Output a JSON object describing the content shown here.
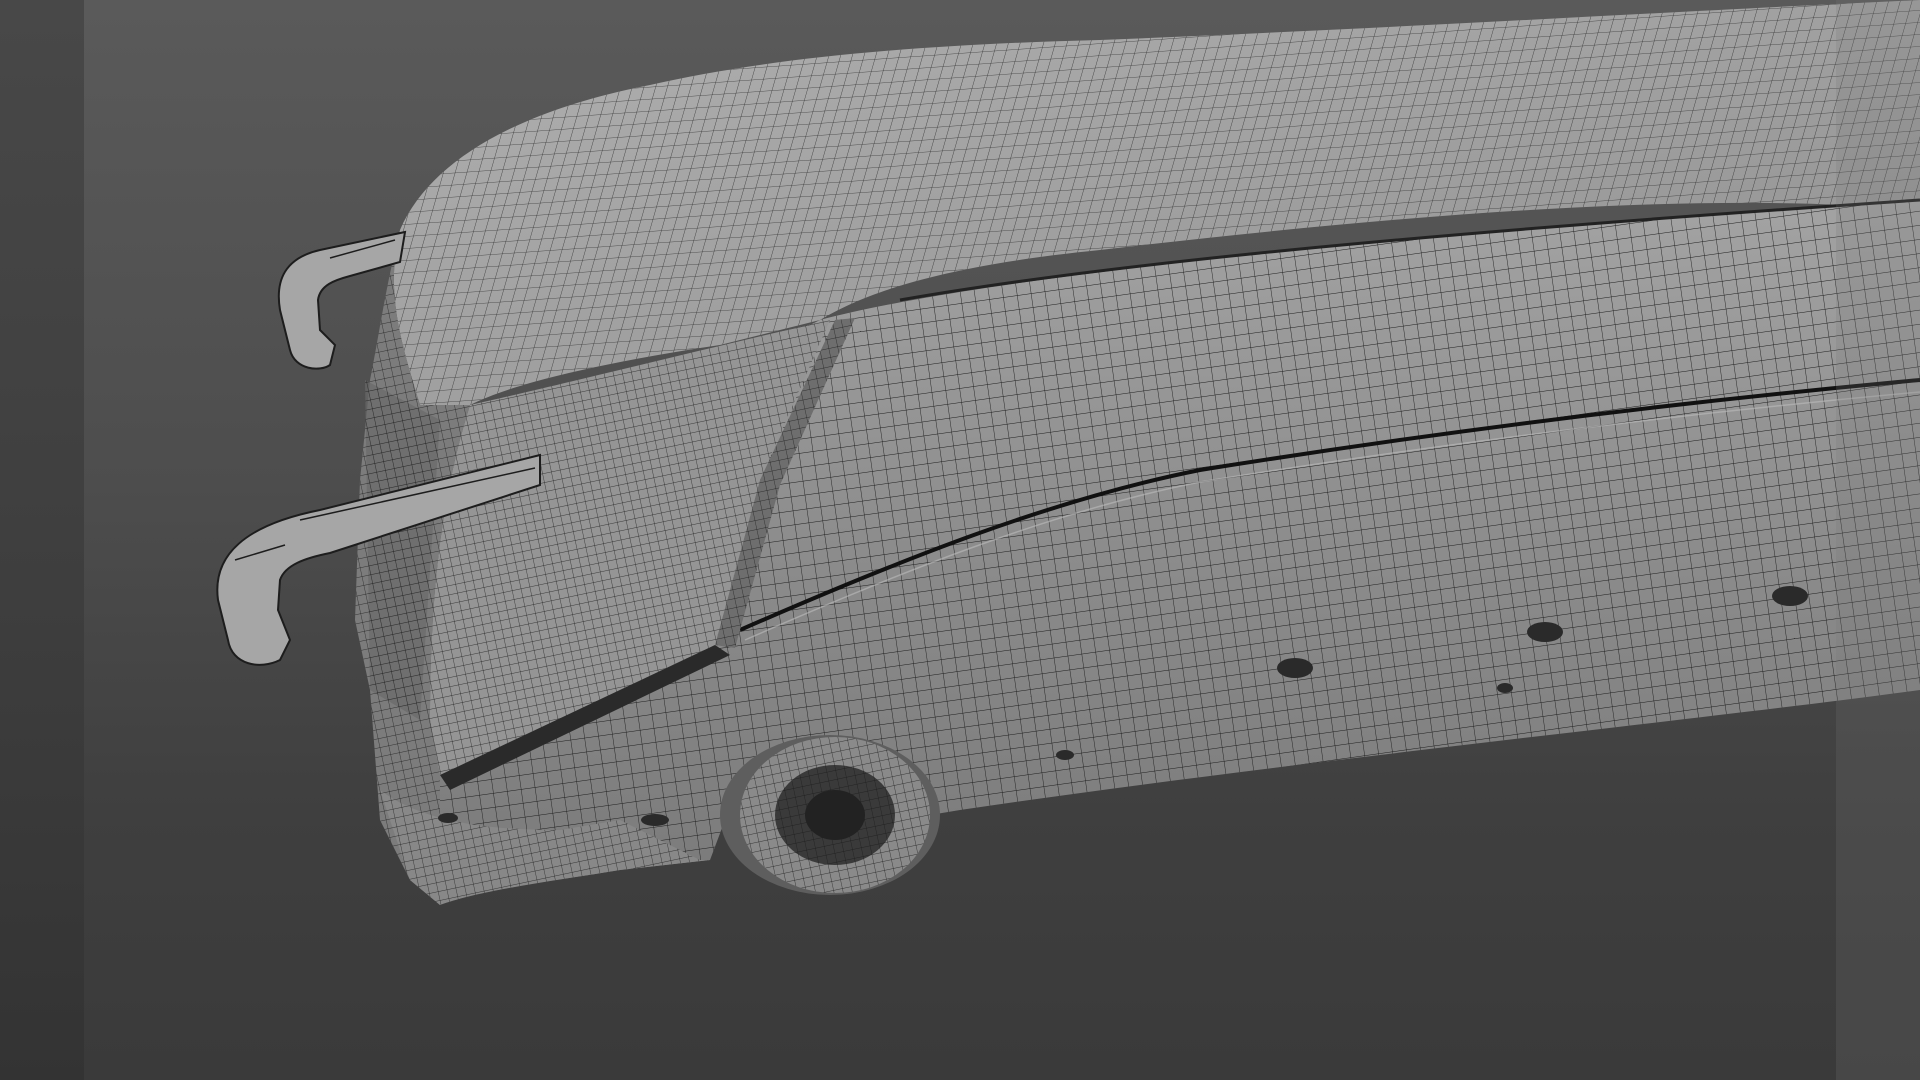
{
  "viewport": {
    "background_top": "#5a5a5a",
    "background_bottom": "#3a3a3a",
    "shading": "wireframe-on-shaded",
    "wire_color": "#1a1a1a",
    "surface_color": "#8a8a8a"
  },
  "model": {
    "subject": "coach-bus",
    "visible_parts": [
      "roof",
      "windshield",
      "side-panels",
      "front-wheel",
      "mirror-upper",
      "mirror-lower",
      "marker-lights",
      "front-bumper"
    ]
  },
  "icons": {
    "mirror_upper": "mirror-arm-icon",
    "mirror_lower": "mirror-arm-icon",
    "wheel": "wheel-icon"
  }
}
